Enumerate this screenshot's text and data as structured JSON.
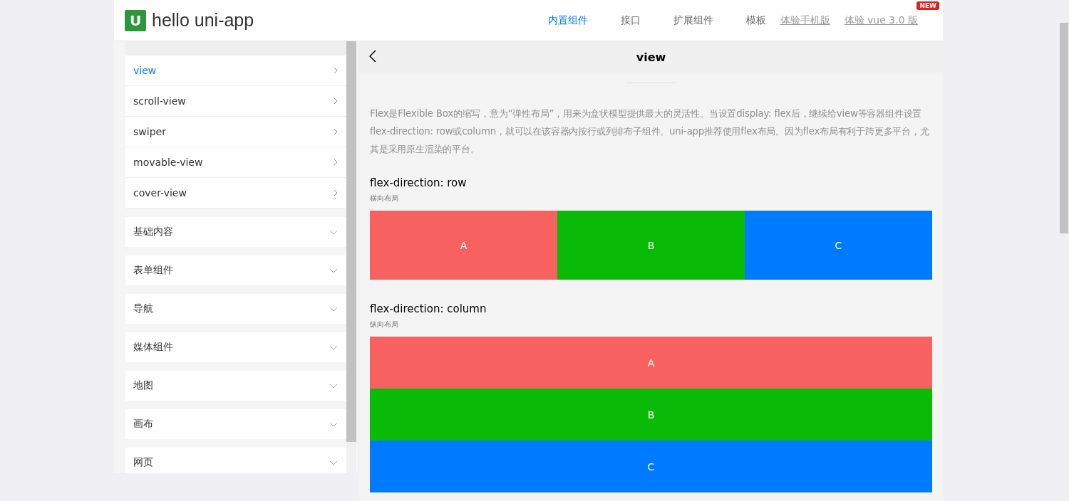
{
  "header": {
    "logo_letter": "U",
    "title": "hello uni-app",
    "nav": [
      {
        "label": "内置组件",
        "selected": true,
        "kind": "tab"
      },
      {
        "label": "接口",
        "selected": false,
        "kind": "tab"
      },
      {
        "label": "扩展组件",
        "selected": false,
        "kind": "tab"
      },
      {
        "label": "模板",
        "selected": false,
        "kind": "tab"
      },
      {
        "label": "体验手机版",
        "selected": false,
        "kind": "link"
      },
      {
        "label": "体验 vue 3.0 版",
        "selected": false,
        "kind": "link",
        "badge": "NEW"
      }
    ]
  },
  "sidebar": {
    "groups": [
      {
        "expanded": true,
        "children": [
          {
            "label": "view",
            "selected": true
          },
          {
            "label": "scroll-view",
            "selected": false
          },
          {
            "label": "swiper",
            "selected": false
          },
          {
            "label": "movable-view",
            "selected": false
          },
          {
            "label": "cover-view",
            "selected": false
          }
        ]
      },
      {
        "label": "基础内容",
        "expanded": false
      },
      {
        "label": "表单组件",
        "expanded": false
      },
      {
        "label": "导航",
        "expanded": false
      },
      {
        "label": "媒体组件",
        "expanded": false
      },
      {
        "label": "地图",
        "expanded": false
      },
      {
        "label": "画布",
        "expanded": false
      },
      {
        "label": "网页",
        "expanded": false
      }
    ]
  },
  "content": {
    "nav_title": "view",
    "intro": "Flex是Flexible Box的缩写，意为“弹性布局”，用来为盒状模型提供最大的灵活性。当设置display: flex后，继续给view等容器组件设置flex-direction: row或column，就可以在该容器内按行或列排布子组件。uni-app推荐使用flex布局。因为flex布局有利于跨更多平台，尤其是采用原生渲染的平台。",
    "demos": [
      {
        "title": "flex-direction: row",
        "subtitle": "横向布局",
        "kind": "row",
        "items": [
          {
            "label": "A",
            "color": "#f76260"
          },
          {
            "label": "B",
            "color": "#09bb07"
          },
          {
            "label": "C",
            "color": "#007aff"
          }
        ]
      },
      {
        "title": "flex-direction: column",
        "subtitle": "纵向布局",
        "kind": "column",
        "items": [
          {
            "label": "A",
            "color": "#f76260"
          },
          {
            "label": "B",
            "color": "#09bb07"
          },
          {
            "label": "C",
            "color": "#007aff"
          }
        ]
      }
    ]
  }
}
